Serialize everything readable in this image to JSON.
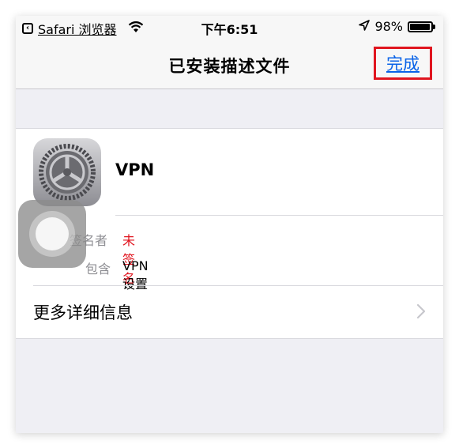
{
  "status_bar": {
    "back_app": "Safari 浏览器",
    "time": "下午6:51",
    "battery_percent": "98%",
    "battery_level": 0.98
  },
  "navbar": {
    "title": "已安装描述文件",
    "done_label": "完成"
  },
  "profile": {
    "name": "VPN",
    "signer_label": "签名者",
    "signer_value": "未签名",
    "contains_label": "包含",
    "contains_value": "VPN 设置"
  },
  "more_details": {
    "label": "更多详细信息"
  },
  "colors": {
    "link_blue": "#0a63e8",
    "highlight_red": "#e0151f",
    "unsigned_red": "#e0151f"
  }
}
